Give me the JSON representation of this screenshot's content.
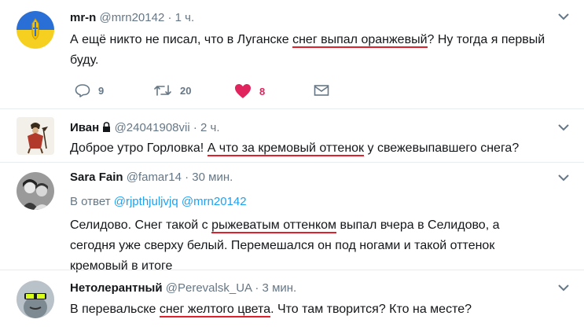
{
  "tweets": [
    {
      "name": "mr-n",
      "handle": "@mrn20142",
      "time": "· 1 ч.",
      "text_a": "А ещё никто не писал, что в Луганске ",
      "text_ul": "снег выпал оранжевый",
      "text_b": "? Ну тогда я первый буду.",
      "reply_count": "9",
      "retweet_count": "20",
      "like_count": "8"
    },
    {
      "name": "Иван",
      "handle": "@24041908vii",
      "time": "· 2 ч.",
      "text_a": "Доброе утро Горловка! ",
      "text_ul": "А что за кремовый оттенок",
      "text_b": " у свежевыпавшего снега?"
    },
    {
      "name": "Sara Fain",
      "handle": "@famar14",
      "time": "· 30 мин.",
      "reply_prefix": "В ответ ",
      "reply_user1": "@rjpthjuljvjq",
      "reply_user2": "@mrn20142",
      "text_a": "Селидово. Снег такой с ",
      "text_ul": "рыжеватым оттенком",
      "text_b": " выпал вчера в Селидово, а сегодня уже сверху белый. Перемешался он под ногами и такой оттенок кремовый в итоге"
    },
    {
      "name": "Нетолерантный",
      "handle": "@Perevalsk_UA",
      "time": "· 3 мин.",
      "text_a": "В перевальске ",
      "text_ul": "снег желтого цвета",
      "text_b": ". Что там творится? Кто на месте?"
    }
  ],
  "icons": {
    "reply": "reply-icon",
    "retweet": "retweet-icon",
    "like": "heart-icon",
    "message": "envelope-icon",
    "more": "chevron-down-icon",
    "protected": "lock-icon"
  },
  "colors": {
    "name": "#14171a",
    "secondary": "#657786",
    "link": "#1da1f2",
    "like": "#e0245e",
    "highlight_underline": "#e0202a"
  }
}
